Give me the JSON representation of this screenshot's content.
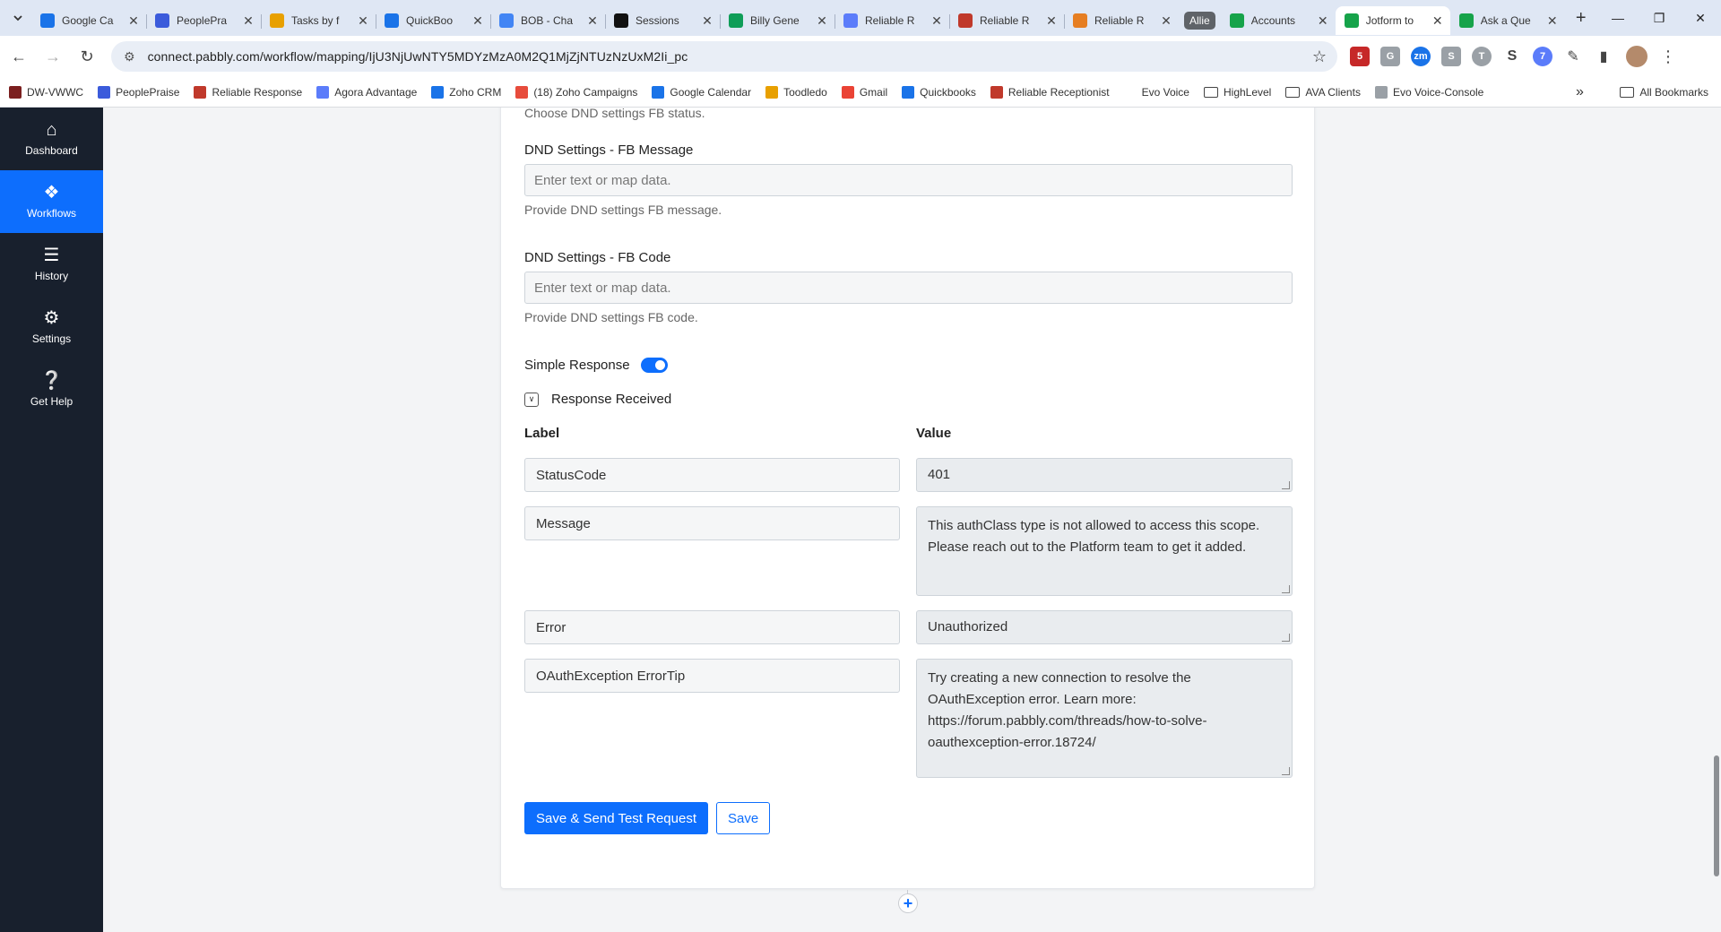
{
  "browser": {
    "tabs": [
      {
        "title": "Google Ca",
        "icon": "google-calendar-icon",
        "color": "#1a73e8"
      },
      {
        "title": "PeoplePra",
        "icon": "peoplepraise-icon",
        "color": "#3b5bdb"
      },
      {
        "title": "Tasks by f",
        "icon": "check-icon",
        "color": "#e8a000"
      },
      {
        "title": "QuickBoo",
        "icon": "quickbooks-icon",
        "color": "#1a73e8"
      },
      {
        "title": "BOB - Cha",
        "icon": "doc-icon",
        "color": "#4285f4"
      },
      {
        "title": "Sessions",
        "icon": "sessions-icon",
        "color": "#111111"
      },
      {
        "title": "Billy Gene",
        "icon": "drive-icon",
        "color": "#0f9d58"
      },
      {
        "title": "Reliable R",
        "icon": "globe-icon",
        "color": "#5b7cfa"
      },
      {
        "title": "Reliable R",
        "icon": "reliable-icon",
        "color": "#c0392b"
      },
      {
        "title": "Reliable R",
        "icon": "brush-icon",
        "color": "#e67e22"
      }
    ],
    "group_label": "Allie",
    "tabs_after_group": [
      {
        "title": "Accounts",
        "icon": "pabbly-icon",
        "color": "#16a34a"
      },
      {
        "title": "Jotform to",
        "icon": "pabbly-icon",
        "color": "#16a34a",
        "active": true
      },
      {
        "title": "Ask a Que",
        "icon": "pabbly-icon",
        "color": "#16a34a"
      }
    ],
    "url": "connect.pabbly.com/workflow/mapping/IjU3NjUwNTY5MDYzMzA0M2Q1MjZjNTUzNzUxM2Ii_pc",
    "bookmarks": [
      {
        "label": "DW-VWWC",
        "color": "#7b1f1f"
      },
      {
        "label": "PeoplePraise",
        "color": "#3b5bdb"
      },
      {
        "label": "Reliable Response",
        "color": "#c0392b"
      },
      {
        "label": "Agora Advantage",
        "color": "#5b7cfa"
      },
      {
        "label": "Zoho CRM",
        "color": "#1a73e8"
      },
      {
        "label": "(18) Zoho Campaigns",
        "color": "#e74c3c"
      },
      {
        "label": "Google Calendar",
        "color": "#1a73e8"
      },
      {
        "label": "Toodledo",
        "color": "#e8a000"
      },
      {
        "label": "Gmail",
        "color": "#ea4335"
      },
      {
        "label": "Quickbooks",
        "color": "#1a73e8"
      },
      {
        "label": "Reliable Receptionist",
        "color": "#c0392b"
      },
      {
        "label": "Evo Voice",
        "color": "#ffffff"
      },
      {
        "label": "HighLevel",
        "folder": true
      },
      {
        "label": "AVA Clients",
        "folder": true
      },
      {
        "label": "Evo Voice-Console",
        "color": "#9aa0a6"
      }
    ],
    "more_label": "»",
    "all_bookmarks": "All Bookmarks"
  },
  "sidebar": {
    "items": [
      {
        "label": "Dashboard",
        "icon": "home-icon"
      },
      {
        "label": "Workflows",
        "icon": "workflow-icon",
        "active": true
      },
      {
        "label": "History",
        "icon": "history-list-icon"
      },
      {
        "label": "Settings",
        "icon": "gear-icon"
      },
      {
        "label": "Get Help",
        "icon": "help-icon"
      }
    ]
  },
  "form": {
    "fb_status_help": "Choose DND settings FB status.",
    "fb_message_label": "DND Settings - FB Message",
    "fb_message_placeholder": "Enter text or map data.",
    "fb_message_help": "Provide DND settings FB message.",
    "fb_code_label": "DND Settings - FB Code",
    "fb_code_placeholder": "Enter text or map data.",
    "fb_code_help": "Provide DND settings FB code.",
    "simple_response_label": "Simple Response",
    "simple_response_on": true,
    "response_received_label": "Response Received",
    "col_label": "Label",
    "col_value": "Value",
    "response_rows": [
      {
        "label": "StatusCode",
        "value": "401"
      },
      {
        "label": "Message",
        "value": "This authClass type is not allowed to access this scope. Please reach out to the Platform team to get it added."
      },
      {
        "label": "Error",
        "value": "Unauthorized"
      },
      {
        "label": "OAuthException ErrorTip",
        "value": "Try creating a new connection to resolve the OAuthException error. Learn more: https://forum.pabbly.com/threads/how-to-solve-oauthexception-error.18724/"
      }
    ],
    "save_send_label": "Save & Send Test Request",
    "save_label": "Save"
  },
  "colors": {
    "primary": "#0d6efd",
    "sidebar_bg": "#18202d"
  }
}
